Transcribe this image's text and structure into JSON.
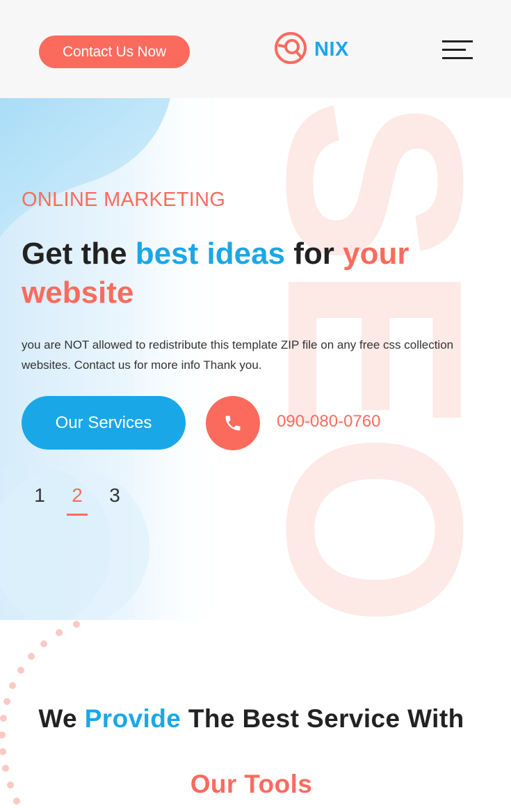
{
  "header": {
    "contact_label": "Contact Us Now",
    "brand": "NIX",
    "menu_icon": "hamburger-menu-icon",
    "logo_icon": "target-logo-icon"
  },
  "hero": {
    "eyebrow": "ONLINE MARKETING",
    "headline": {
      "part1": "Get the ",
      "highlight1": "best ideas",
      "part2": " for ",
      "highlight2": "your website"
    },
    "watermark": "SEO",
    "description": "you are NOT allowed to redistribute this template ZIP file on any free css collection websites. Contact us for more info Thank you.",
    "services_label": "Our Services",
    "phone_icon": "phone-icon",
    "phone_number": "090-080-0760",
    "pager": {
      "pages": [
        "1",
        "2",
        "3"
      ],
      "active": "2"
    }
  },
  "section": {
    "title_part1": "We ",
    "title_highlight": "Provide",
    "title_part2": " The Best Service With",
    "subtitle": "Our Tools"
  },
  "colors": {
    "accent_coral": "#fa6b5e",
    "accent_blue": "#1aa7e8",
    "header_bg": "#f7f7f8",
    "text_dark": "#222222"
  }
}
